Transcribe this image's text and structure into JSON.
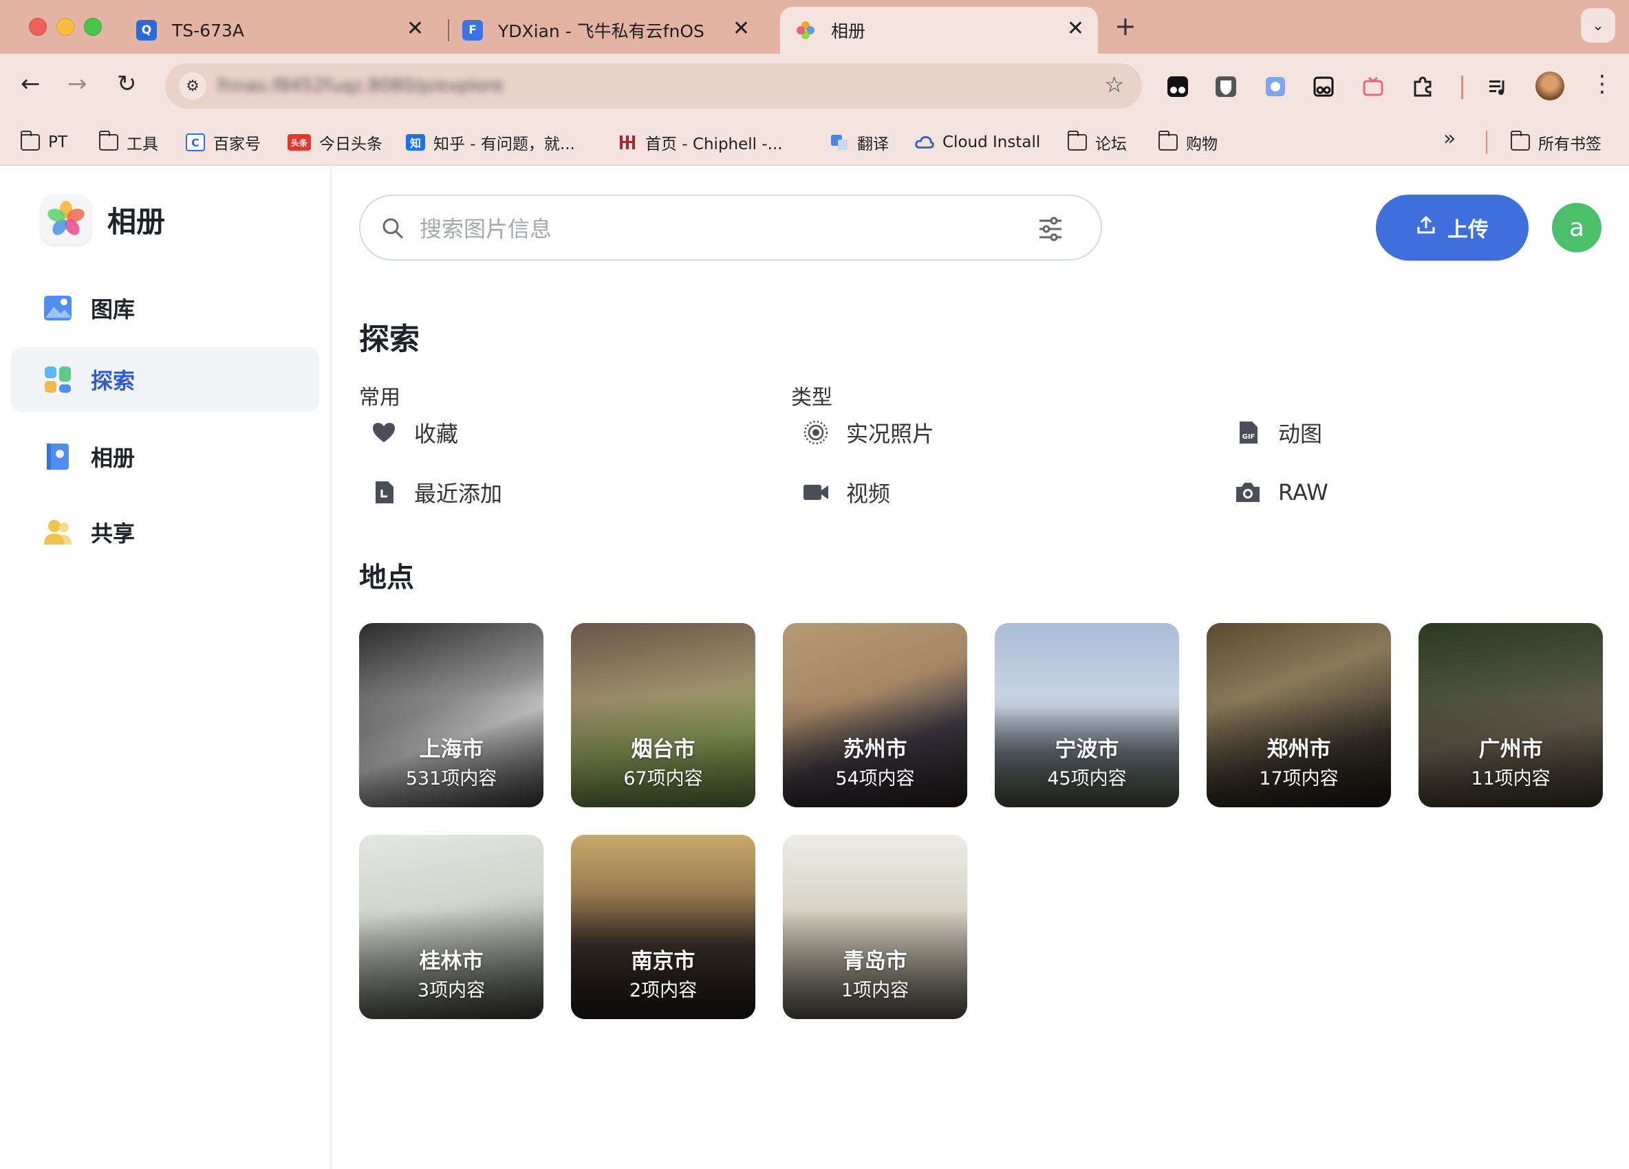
{
  "browser": {
    "tabs": [
      {
        "title": "TS-673A",
        "favicon": "qnap-icon",
        "active": false
      },
      {
        "title": "YDXian - 飞牛私有云fnOS",
        "favicon": "fnos-icon",
        "active": false
      },
      {
        "title": "相册",
        "favicon": "photos-icon",
        "active": true
      }
    ],
    "close_glyph": "✕",
    "new_tab_glyph": "+",
    "url": "fnnas.f8452fuqz.8080/p/explore",
    "bookmarks": [
      {
        "label": "PT",
        "icon": "folder-icon"
      },
      {
        "label": "工具",
        "icon": "folder-icon"
      },
      {
        "label": "百家号",
        "icon": "baijiahao-icon"
      },
      {
        "label": "今日头条",
        "icon": "toutiao-icon"
      },
      {
        "label": "知乎 - 有问题，就...",
        "icon": "zhihu-icon"
      },
      {
        "label": "首页 - Chiphell -...",
        "icon": "chiphell-icon"
      },
      {
        "label": "翻译",
        "icon": "translate-icon"
      },
      {
        "label": "Cloud Install",
        "icon": "cloud-icon"
      },
      {
        "label": "论坛",
        "icon": "folder-icon"
      },
      {
        "label": "购物",
        "icon": "folder-icon"
      }
    ],
    "all_bookmarks_label": "所有书签",
    "overflow_glyph": "»",
    "badge_zhihu": "知",
    "badge_toutiao": "头条",
    "badge_baijiahao": "C",
    "badge_qnap": "Q",
    "badge_fnos": "F"
  },
  "app": {
    "title": "相册",
    "nav": [
      {
        "label": "图库",
        "icon": "gallery-icon",
        "active": false
      },
      {
        "label": "探索",
        "icon": "explore-icon",
        "active": true
      },
      {
        "label": "相册",
        "icon": "album-icon",
        "active": false
      },
      {
        "label": "共享",
        "icon": "share-icon",
        "active": false
      }
    ],
    "search_placeholder": "搜索图片信息",
    "upload_label": "上传",
    "avatar_letter": "a"
  },
  "explore": {
    "title": "探索",
    "common_title": "常用",
    "types_title": "类型",
    "common": [
      {
        "label": "收藏",
        "icon": "heart-icon"
      },
      {
        "label": "最近添加",
        "icon": "recent-icon"
      }
    ],
    "types": [
      {
        "label": "实况照片",
        "icon": "live-photo-icon"
      },
      {
        "label": "动图",
        "icon": "gif-icon"
      },
      {
        "label": "视频",
        "icon": "video-icon"
      },
      {
        "label": "RAW",
        "icon": "camera-icon"
      }
    ],
    "places_title": "地点",
    "places": [
      {
        "name": "上海市",
        "count": "531项内容"
      },
      {
        "name": "烟台市",
        "count": "67项内容"
      },
      {
        "name": "苏州市",
        "count": "54项内容"
      },
      {
        "name": "宁波市",
        "count": "45项内容"
      },
      {
        "name": "郑州市",
        "count": "17项内容"
      },
      {
        "name": "广州市",
        "count": "11项内容"
      },
      {
        "name": "桂林市",
        "count": "3项内容"
      },
      {
        "name": "南京市",
        "count": "2项内容"
      },
      {
        "name": "青岛市",
        "count": "1项内容"
      }
    ]
  },
  "colors": {
    "tabstrip": "#e3b3a3",
    "toolbar": "#f5e3dd",
    "accent": "#3f6fdc",
    "active_nav_text": "#2d5bd0",
    "avatar": "#4bbf6b"
  }
}
